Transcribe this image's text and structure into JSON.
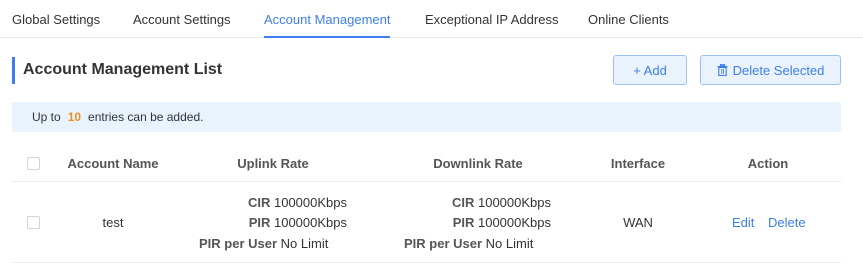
{
  "tabs": [
    {
      "label": "Global Settings"
    },
    {
      "label": "Account Settings"
    },
    {
      "label": "Account Management",
      "active": true
    },
    {
      "label": "Exceptional IP Address"
    },
    {
      "label": "Online Clients"
    }
  ],
  "header": {
    "title": "Account Management List",
    "add_label": "+ Add",
    "delete_selected_label": "Delete Selected"
  },
  "notice": {
    "prefix": "Up to",
    "count": "10",
    "suffix": "entries can be added."
  },
  "table": {
    "columns": [
      "Account Name",
      "Uplink Rate",
      "Downlink Rate",
      "Interface",
      "Action"
    ],
    "rows": [
      {
        "account_name": "test",
        "uplink": {
          "cir_label": "CIR",
          "cir_value": "100000Kbps",
          "pir_label": "PIR",
          "pir_value": "100000Kbps",
          "per_user_label": "PIR per User",
          "per_user_value": "No Limit"
        },
        "downlink": {
          "cir_label": "CIR",
          "cir_value": "100000Kbps",
          "pir_label": "PIR",
          "pir_value": "100000Kbps",
          "per_user_label": "PIR per User",
          "per_user_value": "No Limit"
        },
        "interface": "WAN",
        "actions": {
          "edit": "Edit",
          "delete": "Delete"
        }
      }
    ]
  },
  "colors": {
    "accent": "#3d7eea",
    "notice_bg": "#e9f3fd",
    "notice_count": "#f08c1f"
  }
}
